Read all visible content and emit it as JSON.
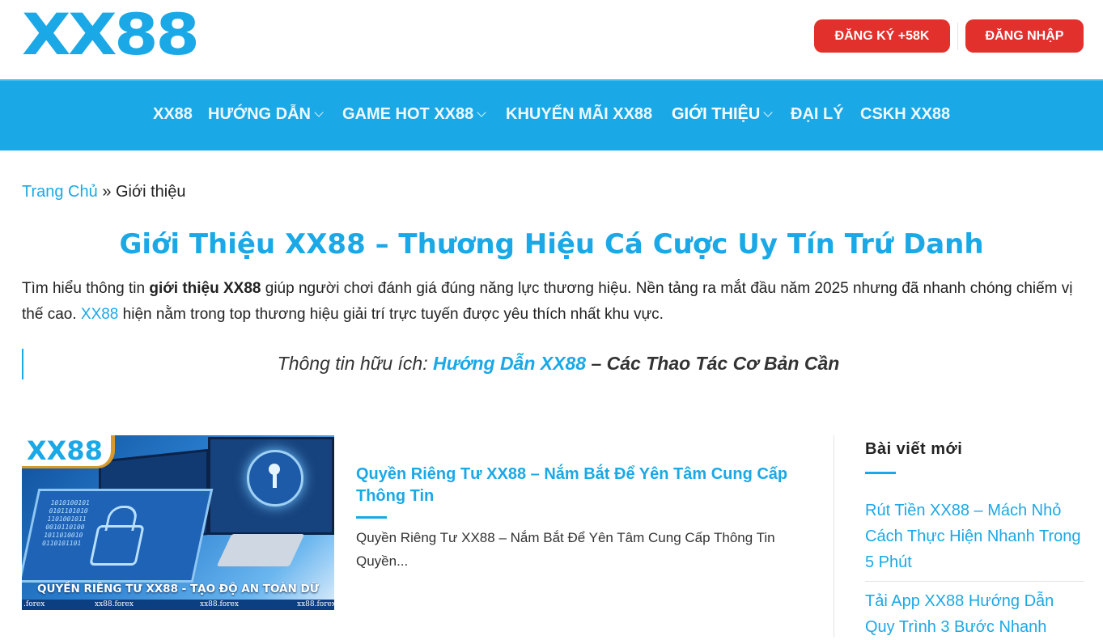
{
  "header": {
    "logo_text": "XX88",
    "register_label": "ĐĂNG KÝ +58K",
    "login_label": "ĐĂNG NHẬP"
  },
  "nav": {
    "items": [
      {
        "label": "XX88",
        "has_dropdown": false
      },
      {
        "label": "HƯỚNG DẪN",
        "has_dropdown": true
      },
      {
        "label": "GAME HOT XX88",
        "has_dropdown": true
      },
      {
        "label": "KHUYẾN MÃI XX88",
        "has_dropdown": false
      },
      {
        "label": "GIỚI THIỆU",
        "has_dropdown": true,
        "active": true
      },
      {
        "label": "ĐẠI LÝ",
        "has_dropdown": false
      },
      {
        "label": "CSKH XX88",
        "has_dropdown": false
      }
    ]
  },
  "breadcrumb": {
    "home": "Trang Chủ",
    "separator": "»",
    "current": "Giới thiệu"
  },
  "article": {
    "title": "Giới Thiệu XX88 – Thương Hiệu Cá Cược Uy Tín Trứ Danh",
    "intro_part1": "Tìm hiểu thông tin ",
    "intro_bold": "giới thiệu XX88",
    "intro_part2": " giúp người chơi đánh giá đúng năng lực thương hiệu. Nền tảng ra mắt đầu năm 2025 nhưng đã nhanh chóng chiếm vị thế cao. ",
    "intro_link": "XX88",
    "intro_part3": " hiện nằm trong top thương hiệu giải trí trực tuyến được yêu thích nhất khu vực.",
    "quote_prefix": "Thông tin hữu ích: ",
    "quote_link": "Hướng Dẫn XX88",
    "quote_suffix": " – Các Thao Tác Cơ Bản Cần"
  },
  "post": {
    "thumb_logo": "XX88",
    "thumb_caption": "QUYỀN RIÊNG TƯ XX88 - TẠO ĐỘ AN TOÀN DỮ LIỆU",
    "thumb_domain_1": ".forex",
    "thumb_domain_2": "xx88.forex",
    "thumb_domain_3": "xx88.forex",
    "thumb_domain_4": "xx88.forex",
    "thumb_binary": "1010100101\n0101101010\n1101001011\n0010110100\n1011010010\n0110101101",
    "title": "Quyền Riêng Tư XX88 – Nắm Bắt Để Yên Tâm Cung Cấp Thông Tin",
    "excerpt": "Quyền Riêng Tư XX88 – Nắm Bắt Để Yên Tâm Cung Cấp Thông Tin Quyền..."
  },
  "sidebar": {
    "title": "Bài viết mới",
    "links": [
      "Rút Tiền XX88 – Mách Nhỏ Cách Thực Hiện Nhanh Trong 5 Phút",
      "Tải App XX88 Hướng Dẫn Quy Trình 3 Bước Nhanh"
    ]
  },
  "colors": {
    "brand_blue": "#1ba8e6",
    "button_red": "#e2302c",
    "text": "#222222"
  }
}
